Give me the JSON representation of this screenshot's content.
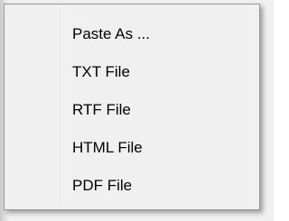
{
  "context_menu": {
    "items": [
      {
        "label": "Paste As ..."
      },
      {
        "label": "TXT File"
      },
      {
        "label": "RTF File"
      },
      {
        "label": "HTML File"
      },
      {
        "label": "PDF File"
      }
    ]
  }
}
